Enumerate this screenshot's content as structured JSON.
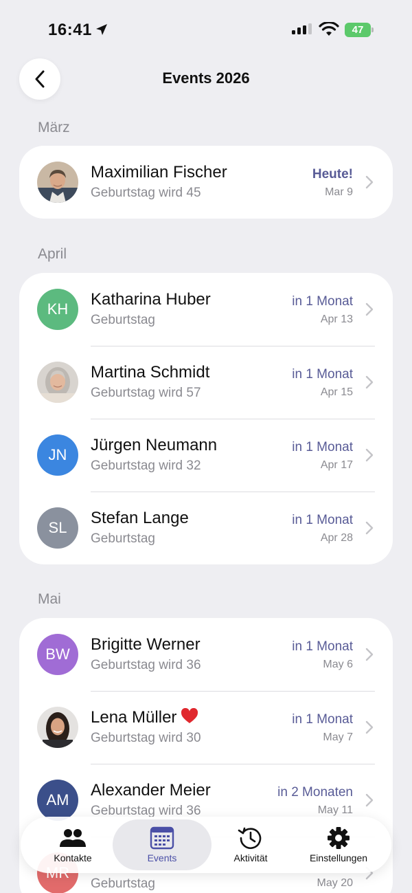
{
  "status_bar": {
    "time": "16:41",
    "battery": "47"
  },
  "nav": {
    "title": "Events 2026"
  },
  "sections": [
    {
      "title": "März"
    },
    {
      "title": "April"
    },
    {
      "title": "Mai"
    }
  ],
  "events": {
    "maximilian": {
      "name": "Maximilian Fischer",
      "subtitle": "Geburtstag wird 45",
      "relative": "Heute!",
      "date": "Mar 9",
      "avatar": "photo"
    },
    "katharina": {
      "name": "Katharina Huber",
      "subtitle": "Geburtstag",
      "relative": "in 1 Monat",
      "date": "Apr 13",
      "initials": "KH",
      "color": "#5cba7f"
    },
    "martina": {
      "name": "Martina Schmidt",
      "subtitle": "Geburtstag wird 57",
      "relative": "in 1 Monat",
      "date": "Apr 15",
      "avatar": "photo"
    },
    "juergen": {
      "name": "Jürgen Neumann",
      "subtitle": "Geburtstag wird 32",
      "relative": "in 1 Monat",
      "date": "Apr 17",
      "initials": "JN",
      "color": "#3b86e0"
    },
    "stefan": {
      "name": "Stefan Lange",
      "subtitle": "Geburtstag",
      "relative": "in 1 Monat",
      "date": "Apr 28",
      "initials": "SL",
      "color": "#8a919e"
    },
    "brigitte": {
      "name": "Brigitte Werner",
      "subtitle": "Geburtstag wird 36",
      "relative": "in 1 Monat",
      "date": "May 6",
      "initials": "BW",
      "color": "#a06cd5"
    },
    "lena": {
      "name": "Lena Müller",
      "subtitle": "Geburtstag wird 30",
      "relative": "in 1 Monat",
      "date": "May 7",
      "avatar": "photo",
      "icon": "heart-icon"
    },
    "alexander": {
      "name": "Alexander Meier",
      "subtitle": "Geburtstag wird 36",
      "relative": "in 2 Monaten",
      "date": "May 11",
      "initials": "AM",
      "color": "#3b4f8a"
    },
    "partial": {
      "subtitle": "Geburtstag",
      "date": "May 20",
      "initials": "MR",
      "color": "#e26b6b"
    }
  },
  "tabs": [
    {
      "label": "Kontakte",
      "icon": "people-icon"
    },
    {
      "label": "Events",
      "icon": "calendar-icon",
      "active": true
    },
    {
      "label": "Aktivität",
      "icon": "history-icon"
    },
    {
      "label": "Einstellungen",
      "icon": "gear-icon"
    }
  ],
  "colors": {
    "accent": "#585b96",
    "background": "#eeeef2",
    "tab_active": "#4a4fa6"
  }
}
